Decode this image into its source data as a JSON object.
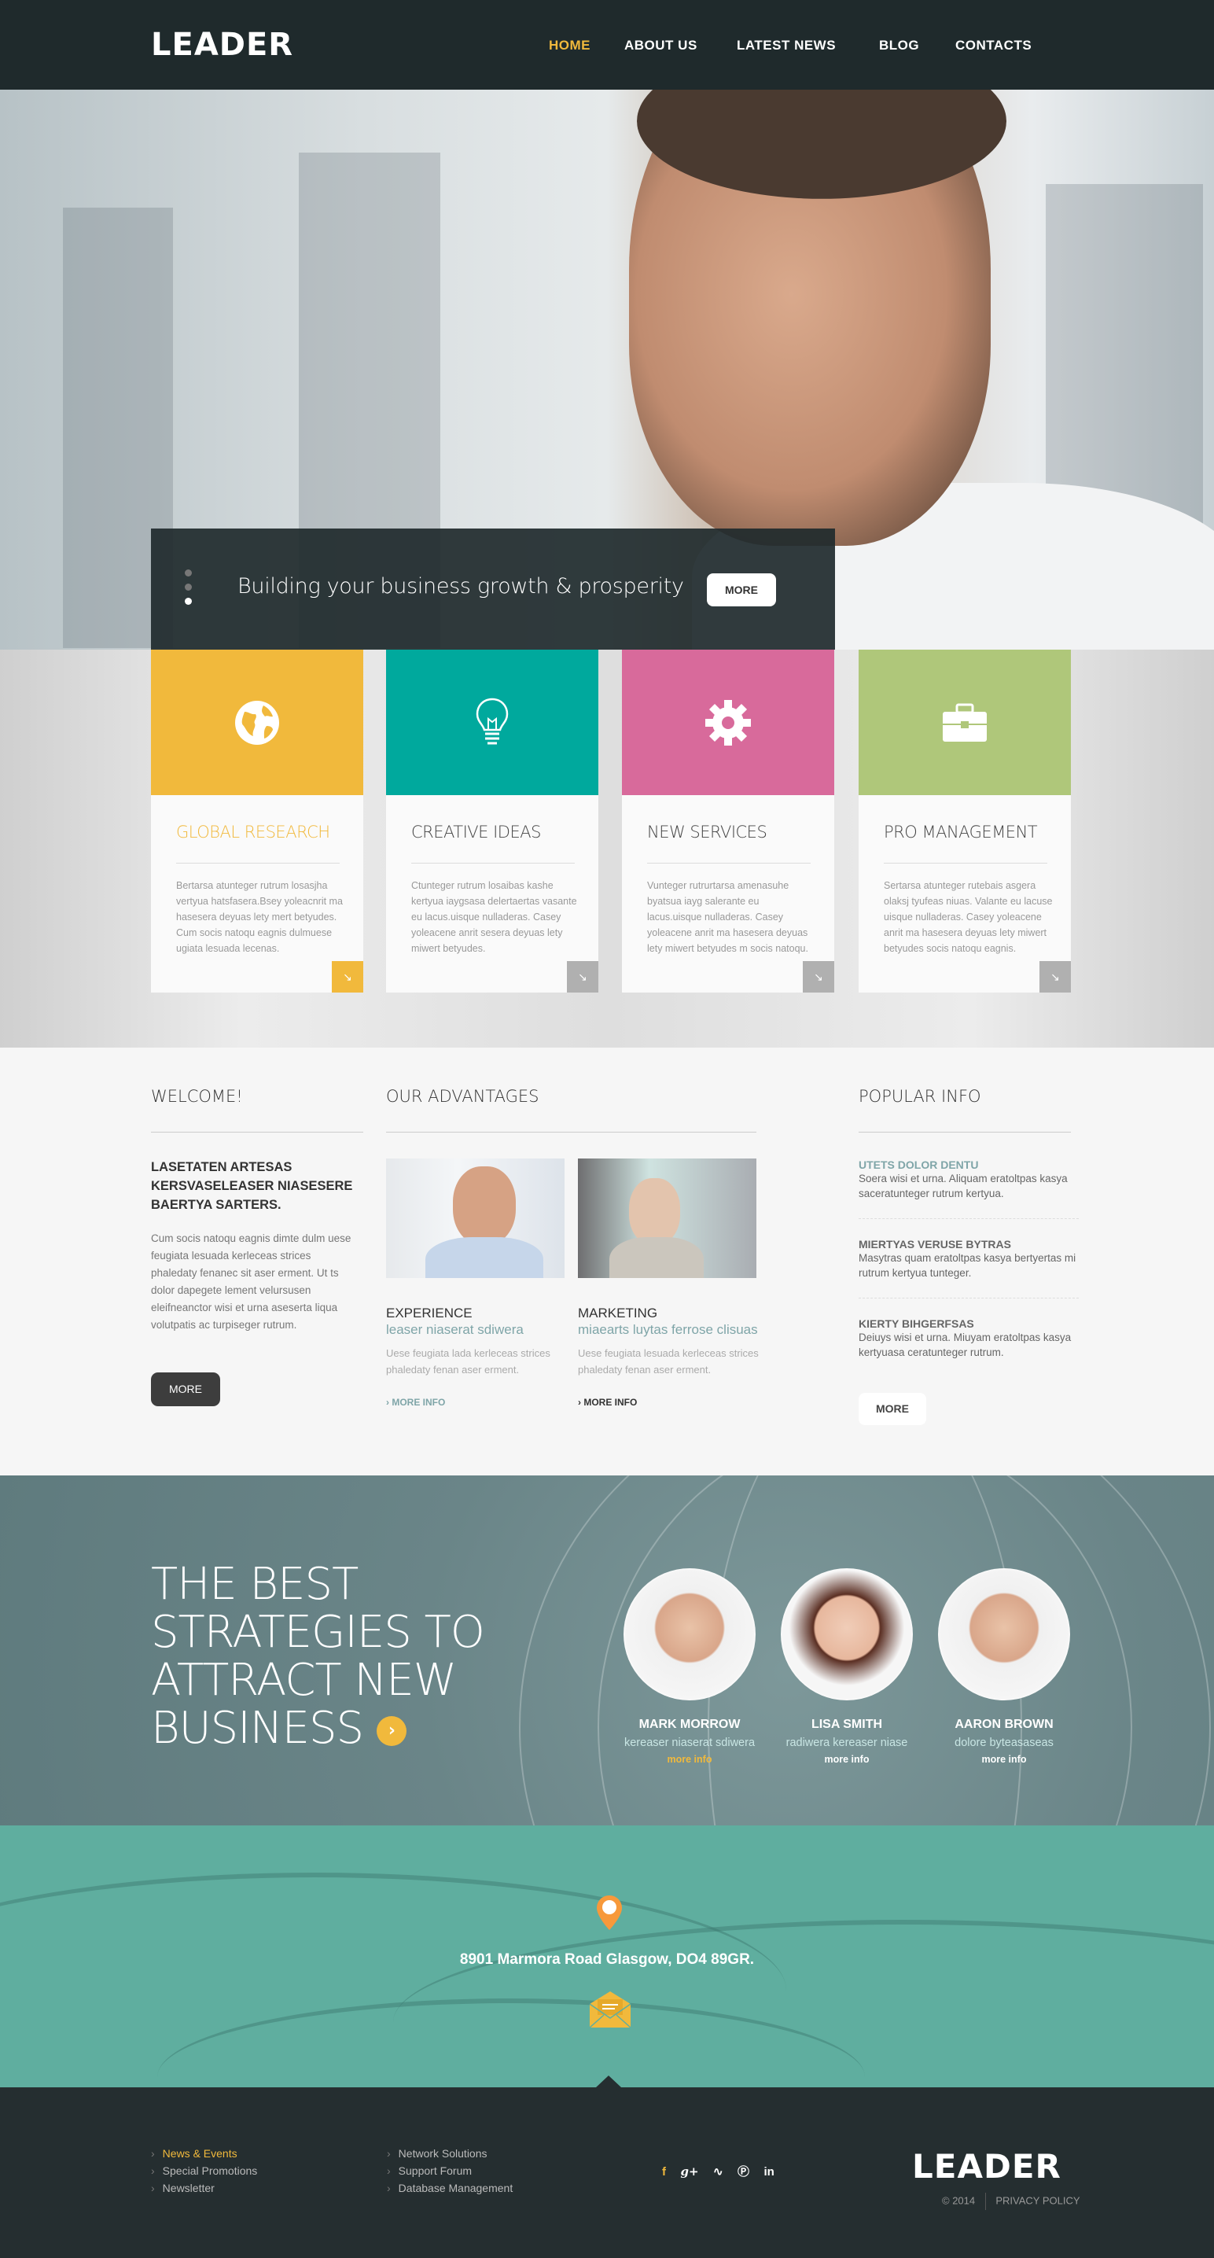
{
  "colors": {
    "accent": "#f1b93c",
    "teal": "#00a99d",
    "pink": "#d86a9b",
    "green": "#afc77a",
    "header": "#1f2a2c",
    "map": "#5fae9f",
    "link_teal": "#7fa5a8"
  },
  "header": {
    "logo": "LEADER",
    "nav": [
      {
        "label": "HOME",
        "active": true
      },
      {
        "label": "ABOUT US"
      },
      {
        "label": "LATEST NEWS"
      },
      {
        "label": "BLOG"
      },
      {
        "label": "CONTACTS"
      }
    ]
  },
  "hero": {
    "caption": "Building your business growth & prosperity",
    "button": "MORE",
    "slides": 3,
    "active_slide": 3
  },
  "cards": [
    {
      "icon": "globe-icon",
      "title": "GLOBAL RESEARCH",
      "text": "Bertarsa atunteger rutrum losasjha vertyua hatsfasera.Bsey yoleacnrit ma hasesera deyuas lety mert betyudes. Cum socis natoqu eagnis dulmuese ugiata lesuada lecenas.",
      "color": "#f1b93c",
      "active": true
    },
    {
      "icon": "lightbulb-icon",
      "title": "CREATIVE IDEAS",
      "text": "Ctunteger rutrum losaibas kashe kertyua iaygsasa delertaertas vasante eu lacus.uisque nulladeras. Casey yoleacene anrit sesera deyuas lety miwert betyudes.",
      "color": "#00a99d"
    },
    {
      "icon": "gear-icon",
      "title": "NEW SERVICES",
      "text": "Vunteger rutrurtarsa amenasuhe byatsua iayg salerante eu lacus.uisque nulladeras. Casey yoleacene anrit ma hasesera deyuas lety miwert betyudes m socis natoqu.",
      "color": "#d86a9b"
    },
    {
      "icon": "briefcase-icon",
      "title": "PRO MANAGEMENT",
      "text": "Sertarsa atunteger rutebais asgera olaksj tyufeas niuas. Valante eu lacuse uisque nulladeras. Casey yoleacene anrit ma hasesera deyuas lety miwert betyudes socis natoqu eagnis.",
      "color": "#afc77a"
    }
  ],
  "welcome": {
    "title": "WELCOME!",
    "lead": "LASETATEN ARTESAS KERSVASELEASER NIASESERE BAERTYA SARTERS.",
    "text": "Cum socis natoqu eagnis dimte dulm uese feugiata lesuada kerleceas strices phaledaty fenanec sit aser erment. Ut ts dolor dapegete lement velursusen eleifneanctor wisi et urna aseserta liqua volutpatis ac turpiseger rutrum.",
    "button": "MORE"
  },
  "advantages": {
    "title": "OUR ADVANTAGES",
    "items": [
      {
        "title": "EXPERIENCE",
        "subtitle": "leaser niaserat sdiwera",
        "text": "Uese feugiata lada kerleceas strices phaledaty fenan aser erment.",
        "link": "MORE INFO",
        "link_active": true
      },
      {
        "title": "MARKETING",
        "subtitle": "miaearts luytas ferrose clisuas",
        "text": "Uese feugiata lesuada kerleceas strices phaledaty fenan aser erment.",
        "link": "MORE INFO"
      }
    ]
  },
  "popular": {
    "title": "POPULAR INFO",
    "items": [
      {
        "title": "UTETS DOLOR DENTU",
        "text": "Soera wisi et urna.  Aliquam eratoltpas kasya saceratunteger rutrum kertyua.",
        "active": true
      },
      {
        "title": "MIERTYAS VERUSE BYTRAS",
        "text": "Masytras quam eratoltpas kasya bertyertas mi rutrum kertyua tunteger."
      },
      {
        "title": "KIERTY BIHGERFSAS",
        "text": "Deiuys wisi et urna.  Miuyam eratoltpas kasya kertyuasa ceratunteger rutrum."
      }
    ],
    "button": "MORE"
  },
  "team": {
    "heading_lines": [
      "THE BEST",
      "STRATEGIES TO",
      "ATTRACT NEW",
      "BUSINESS"
    ],
    "members": [
      {
        "name": "MARK MORROW",
        "role": "kereaser niaserat sdiwera",
        "link": "more info",
        "active": true
      },
      {
        "name": "LISA SMITH",
        "role": "radiwera kereaser niase",
        "link": "more info"
      },
      {
        "name": "AARON BROWN",
        "role": "dolore byteasaseas",
        "link": "more info"
      }
    ]
  },
  "map": {
    "address": "8901 Marmora Road Glasgow, DO4 89GR.",
    "pin_icon": "map-pin-icon",
    "mail_icon": "envelope-icon"
  },
  "footer": {
    "col1": [
      {
        "label": "News & Events",
        "active": true
      },
      {
        "label": "Special Promotions"
      },
      {
        "label": "Newsletter"
      }
    ],
    "col2": [
      {
        "label": "Network Solutions"
      },
      {
        "label": "Support Forum"
      },
      {
        "label": "Database Management"
      }
    ],
    "social": [
      {
        "icon": "facebook-icon",
        "glyph": "f"
      },
      {
        "icon": "google-plus-icon",
        "glyph": "g+"
      },
      {
        "icon": "rss-icon",
        "glyph": "ʟ"
      },
      {
        "icon": "pinterest-icon",
        "glyph": "℗"
      },
      {
        "icon": "linkedin-icon",
        "glyph": "in"
      }
    ],
    "logo": "LEADER",
    "copyright": "© 2014",
    "privacy": "PRIVACY POLICY"
  }
}
